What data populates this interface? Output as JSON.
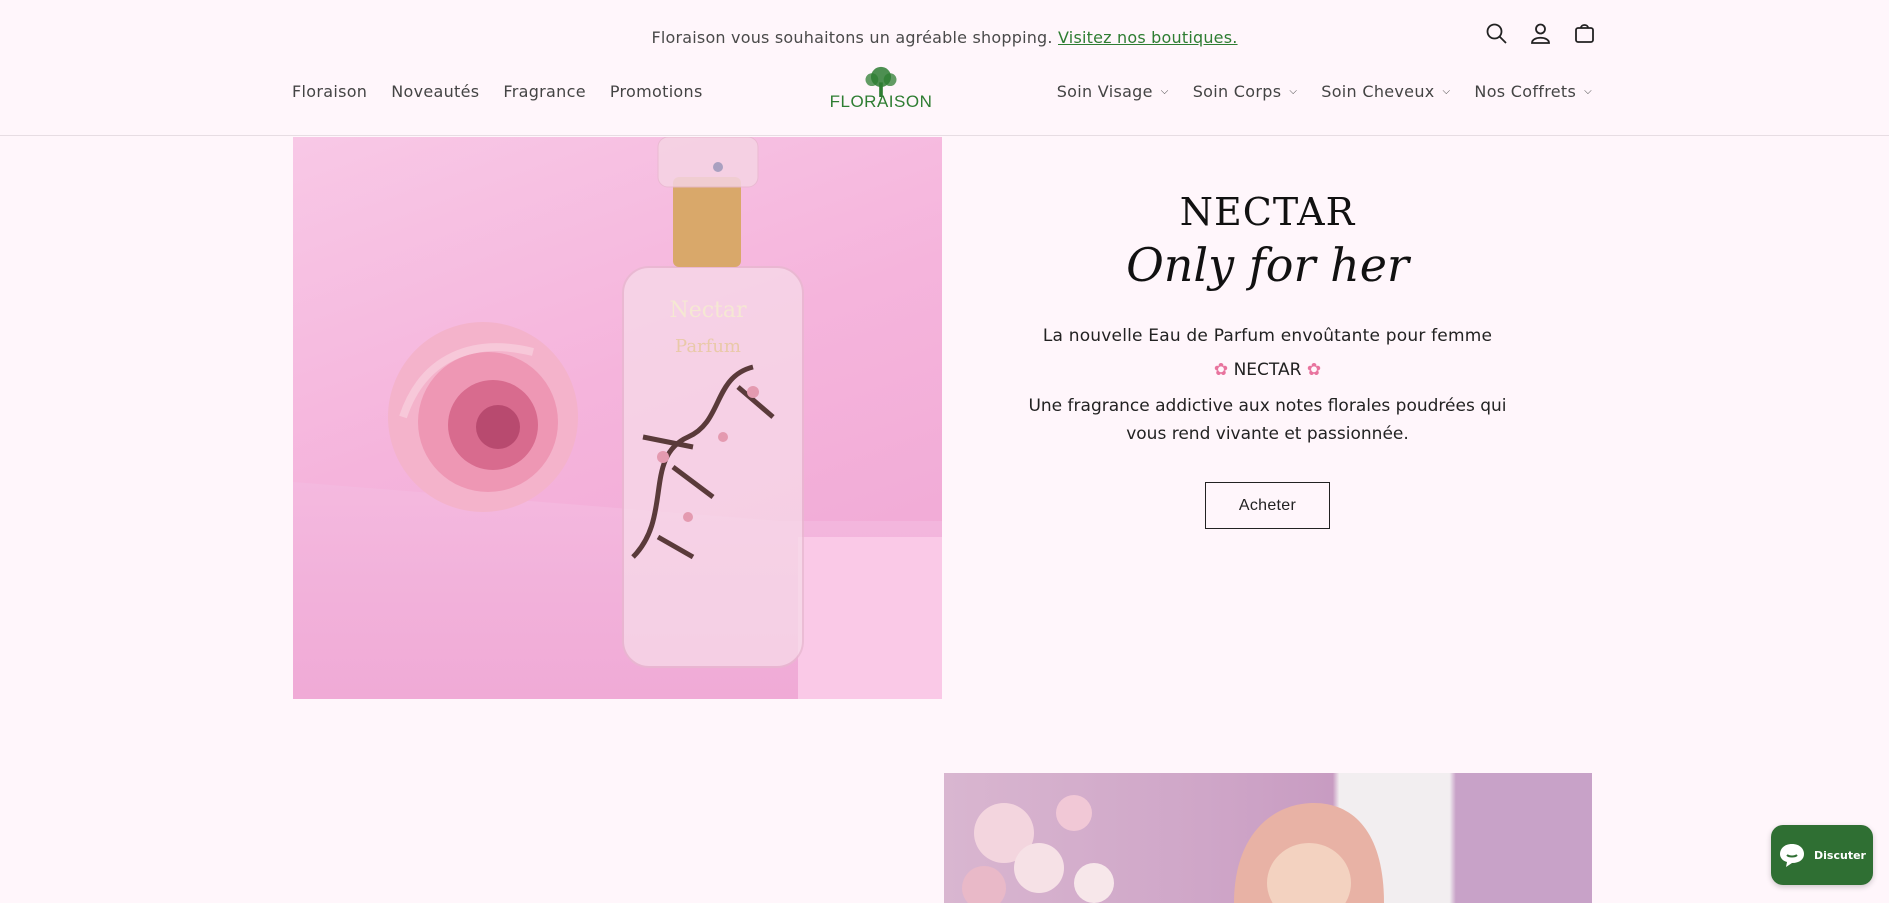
{
  "announcement": {
    "text": "Floraison vous souhaitons un agréable shopping.",
    "link": "Visitez nos boutiques."
  },
  "header": {
    "logo_text": "FLORAISON",
    "nav_left": [
      "Floraison",
      "Noveautés",
      "Fragrance",
      "Promotions"
    ],
    "nav_right": [
      "Soin Visage",
      "Soin Corps",
      "Soin Cheveux",
      "Nos Coffrets"
    ],
    "icons": [
      "search-icon",
      "account-icon",
      "cart-icon"
    ]
  },
  "hero": {
    "title": "NECTAR",
    "script": "Only for her",
    "line1": "La nouvelle Eau de Parfum envoûtante pour femme",
    "line2": "NECTAR",
    "description": "Une fragrance addictive aux notes florales poudrées qui vous rend vivante et passionnée.",
    "cta": "Acheter",
    "image_text_1": "Nectar",
    "image_text_2": "Parfum"
  },
  "chat": {
    "label": "Discuter"
  },
  "colors": {
    "accent": "#2e7d32",
    "background": "#fff6fb",
    "chat": "#2f6f33"
  }
}
